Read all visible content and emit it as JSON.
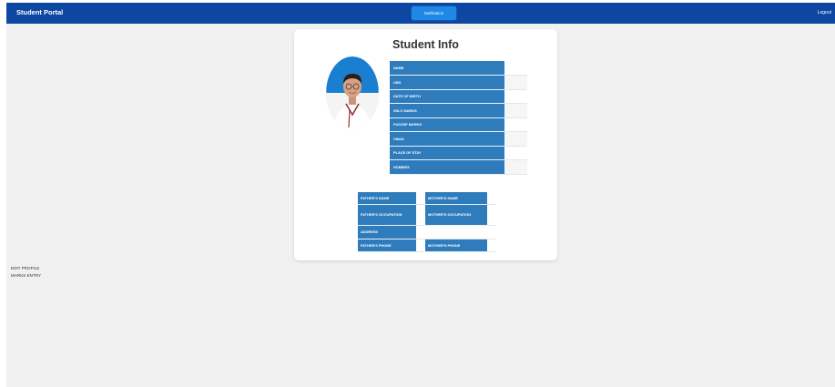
{
  "navbar": {
    "brand": "Student Portal",
    "notification_label": "Notification",
    "logout_label": "Logout",
    "background_color": "#0d47a1",
    "button_color": "#1e88e5"
  },
  "card": {
    "title": "Student Info",
    "photo_icon": "student-avatar"
  },
  "student_fields": [
    {
      "label": "NAME",
      "value": ""
    },
    {
      "label": "USN",
      "value": ""
    },
    {
      "label": "DATE OF BIRTH",
      "value": ""
    },
    {
      "label": "SSLC MARKS",
      "value": ""
    },
    {
      "label": "PUC/DIP MARKS",
      "value": ""
    },
    {
      "label": "CMAIL",
      "value": ""
    },
    {
      "label": "PLACE OF STAY",
      "value": ""
    },
    {
      "label": "HOBBIES",
      "value": ""
    }
  ],
  "parent_fields": {
    "father_name": "FATHER'S NAME",
    "mother_name": "MOTHER'S NAME",
    "father_occupation": "FATHER'S OCCUPATION",
    "mother_occupation": "MOTHER'S OCCUPATION",
    "address": "ADDRESS",
    "father_phone": "FATHER'S PHONE",
    "mother_phone": "MOTHER'S PHONE"
  },
  "sidebar": {
    "items": [
      {
        "label": "EDIT PROFILE"
      },
      {
        "label": "MARKS ENTRY"
      }
    ]
  },
  "colors": {
    "label_cell": "#2f7cbd",
    "card_background": "#ffffff",
    "page_background": "#f0f0f0"
  }
}
